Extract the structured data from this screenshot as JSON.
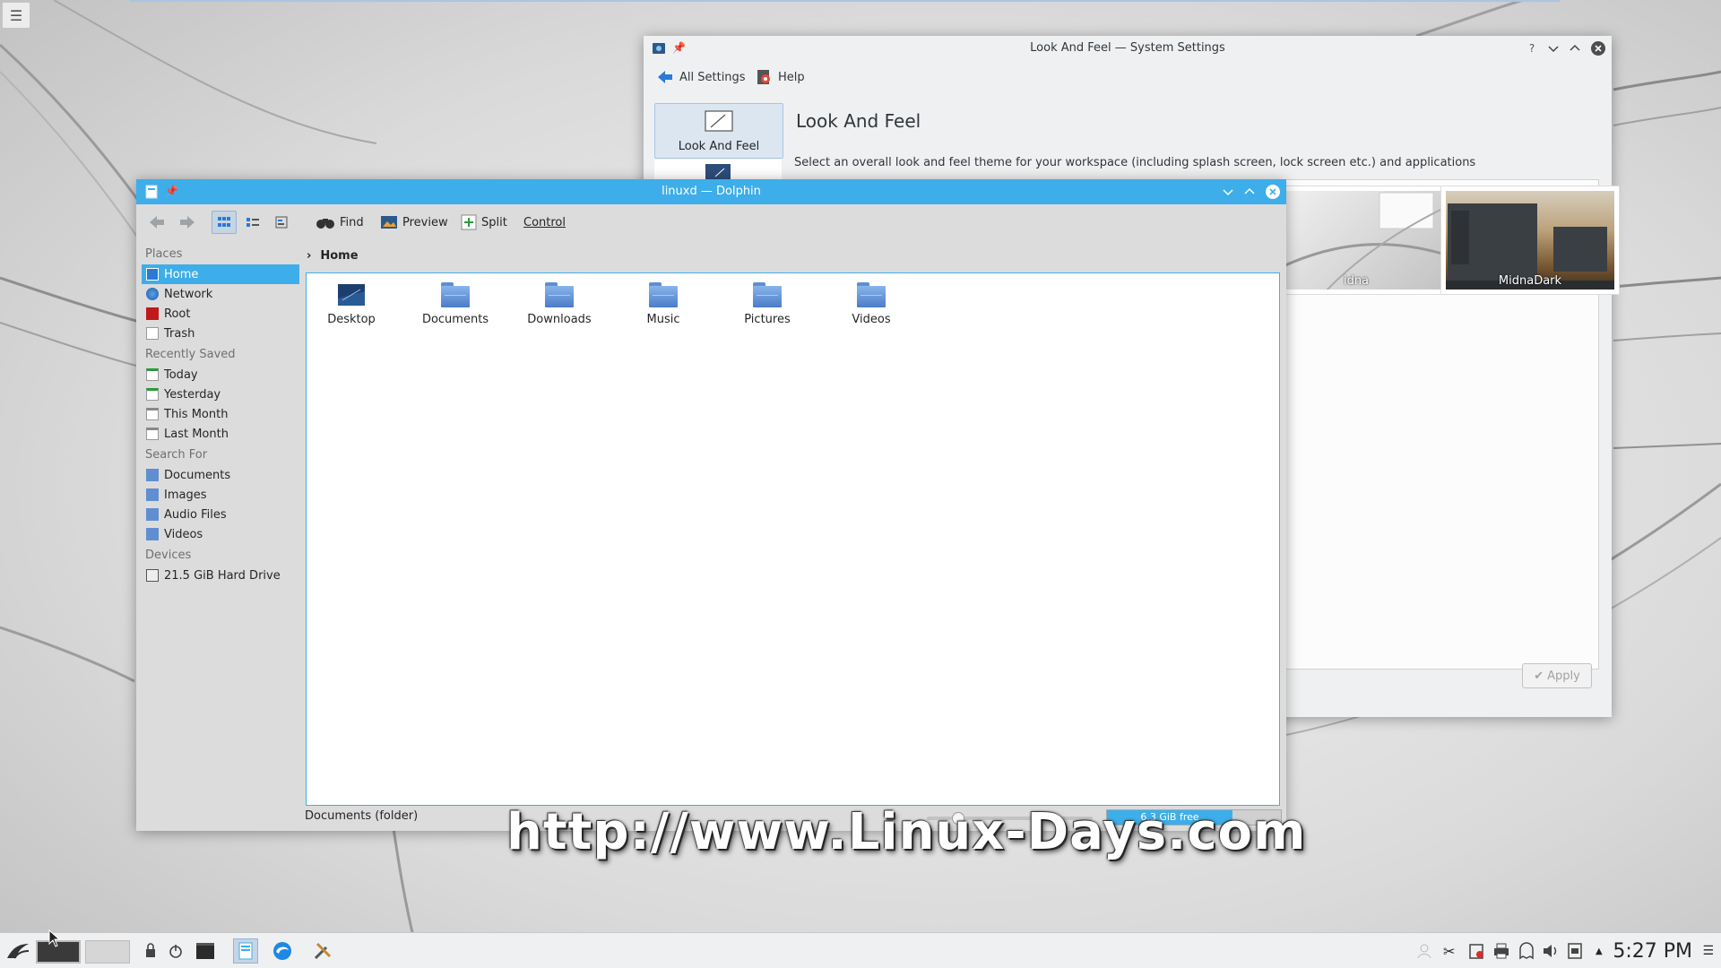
{
  "settings": {
    "title": "Look And Feel — System Settings",
    "toolbar": {
      "all_settings": "All Settings",
      "help": "Help"
    },
    "sidebar_item": "Look And Feel",
    "heading": "Look And Feel",
    "description": "Select an overall look and feel theme for your workspace (including splash screen, lock screen etc.) and applications",
    "themes": [
      {
        "name": "idna"
      },
      {
        "name": "MidnaDark"
      }
    ],
    "apply_label": "Apply",
    "titlebar_buttons": {
      "help": "?"
    }
  },
  "dolphin": {
    "title": "linuxd — Dolphin",
    "toolbar": {
      "find": "Find",
      "preview": "Preview",
      "split": "Split",
      "control": "Control"
    },
    "places": {
      "places_head": "Places",
      "places": [
        "Home",
        "Network",
        "Root",
        "Trash"
      ],
      "recent_head": "Recently Saved",
      "recent": [
        "Today",
        "Yesterday",
        "This Month",
        "Last Month"
      ],
      "search_head": "Search For",
      "search": [
        "Documents",
        "Images",
        "Audio Files",
        "Videos"
      ],
      "devices_head": "Devices",
      "devices": [
        "21.5 GiB Hard Drive"
      ]
    },
    "breadcrumb": "Home",
    "files": [
      "Desktop",
      "Documents",
      "Downloads",
      "Music",
      "Pictures",
      "Videos"
    ],
    "status": "Documents (folder)",
    "free_space": "6.3 GiB free",
    "free_space_used_fraction": 0.72
  },
  "watermark": "http://www.Linux-Days.com",
  "taskbar": {
    "clock": "5:27 PM"
  },
  "colors": {
    "accent": "#3daee9",
    "folder": "#5f8fd0"
  }
}
